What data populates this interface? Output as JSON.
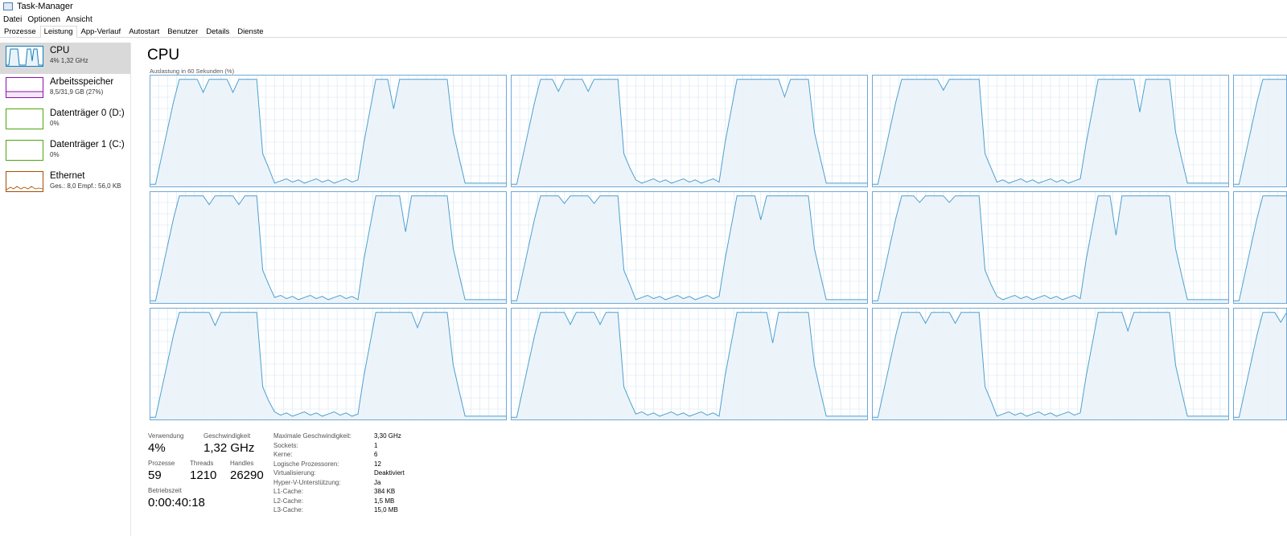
{
  "window": {
    "title": "Task-Manager"
  },
  "menu": {
    "file": "Datei",
    "options": "Optionen",
    "view": "Ansicht"
  },
  "tabs": [
    "Prozesse",
    "Leistung",
    "App-Verlauf",
    "Autostart",
    "Benutzer",
    "Details",
    "Dienste"
  ],
  "active_tab": "Leistung",
  "sidebar": {
    "items": [
      {
        "title": "CPU",
        "sub": "4% 1,32 GHz",
        "color": "#117dbb"
      },
      {
        "title": "Arbeitsspeicher",
        "sub": "8,5/31,9 GB (27%)",
        "color": "#8b12ae"
      },
      {
        "title": "Datenträger 0 (D:)",
        "sub": "0%",
        "color": "#4da60c"
      },
      {
        "title": "Datenträger 1 (C:)",
        "sub": "0%",
        "color": "#4da60c"
      },
      {
        "title": "Ethernet",
        "sub": "Ges.: 8,0 Empf.: 56,0 KB",
        "color": "#a74f01"
      }
    ]
  },
  "main": {
    "title": "CPU",
    "graph_caption": "Auslastung in 60 Sekunden (%)",
    "stats": {
      "usage_label": "Verwendung",
      "usage": "4%",
      "speed_label": "Geschwindigkeit",
      "speed": "1,32 GHz",
      "processes_label": "Prozesse",
      "processes": "59",
      "threads_label": "Threads",
      "threads": "1210",
      "handles_label": "Handles",
      "handles": "26290",
      "uptime_label": "Betriebszeit",
      "uptime": "0:00:40:18"
    },
    "details": [
      {
        "k": "Maximale Geschwindigkeit:",
        "v": "3,30 GHz"
      },
      {
        "k": "Sockets:",
        "v": "1"
      },
      {
        "k": "Kerne:",
        "v": "6"
      },
      {
        "k": "Logische Prozessoren:",
        "v": "12"
      },
      {
        "k": "Virtualisierung:",
        "v": "Deaktiviert"
      },
      {
        "k": "Hyper-V-Unterstützung:",
        "v": "Ja"
      },
      {
        "k": "L1-Cache:",
        "v": "384 KB"
      },
      {
        "k": "L2-Cache:",
        "v": "1,5 MB"
      },
      {
        "k": "L3-Cache:",
        "v": "15,0 MB"
      }
    ]
  },
  "colors": {
    "cpu_line": "#4e9fcf",
    "cpu_fill": "#eaf3fa",
    "cpu_border": "#6fa8d6",
    "grid": "#d3e5f2"
  }
}
